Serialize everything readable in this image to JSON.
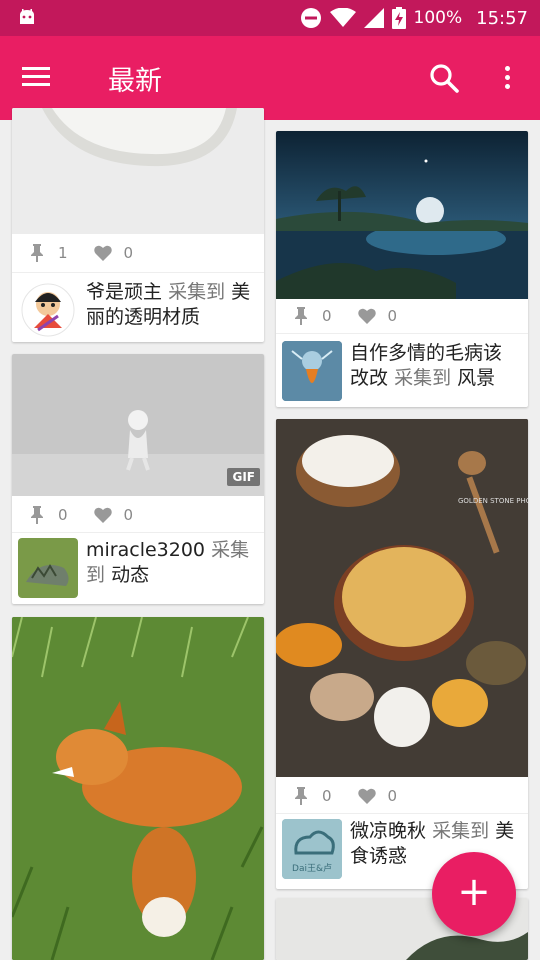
{
  "status_bar": {
    "battery": "100%",
    "time": "15:57"
  },
  "toolbar": {
    "title": "最新"
  },
  "cards": [
    {
      "pins": "1",
      "likes": "0",
      "user": "爷是顽主",
      "verb": "采集到",
      "board": "美丽的透明材质"
    },
    {
      "pins": "0",
      "likes": "0",
      "user": "自作多情的毛病该改改",
      "verb": "采集到",
      "board": "风景"
    },
    {
      "pins": "0",
      "likes": "0",
      "user": "miracle3200",
      "verb": "采集到",
      "board": "动态",
      "badge": "GIF"
    },
    {
      "pins": "0",
      "likes": "0",
      "user": "微凉晚秋",
      "verb": "采集到",
      "board": "美食诱惑",
      "image_watermark": "GOLDEN STONE PHOTOGRAPHY",
      "avatar_text": "Dai王&卢"
    }
  ],
  "fab": {
    "label": "+"
  },
  "colors": {
    "primary": "#e91e63",
    "primary_dark": "#c2185b"
  }
}
